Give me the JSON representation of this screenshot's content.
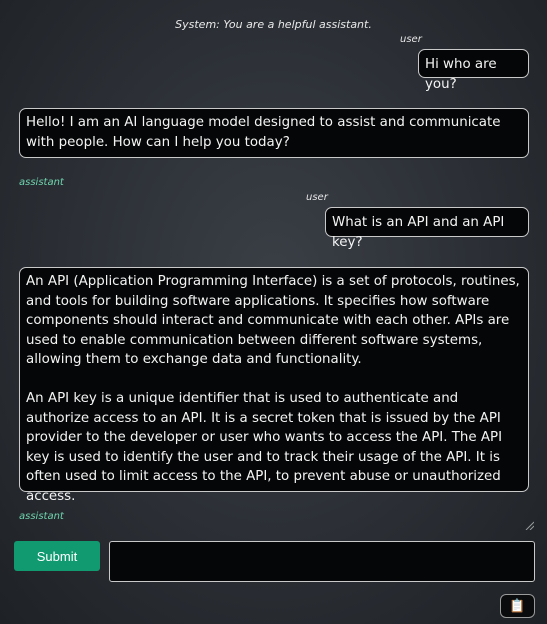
{
  "system_prompt": "System: You are a helpful assistant.",
  "messages": [
    {
      "role": "user",
      "role_label": "user",
      "text": "Hi who are you?"
    },
    {
      "role": "assistant",
      "role_label": "assistant",
      "text": "Hello! I am an AI language model designed to assist and communicate with people. How can I help you today?"
    },
    {
      "role": "user",
      "role_label": "user",
      "text": "What is an API and an API key?"
    },
    {
      "role": "assistant",
      "role_label": "assistant",
      "text": "An API (Application Programming Interface) is a set of protocols, routines, and tools for building software applications. It specifies how software components should interact and communicate with each other. APIs are used to enable communication between different software systems, allowing them to exchange data and functionality.\n\nAn API key is a unique identifier that is used to authenticate and authorize access to an API. It is a secret token that is issued by the API provider to the developer or user who wants to access the API. The API key is used to identify the user and to track their usage of the API. It is often used to limit access to the API, to prevent abuse or unauthorized access."
    }
  ],
  "composer": {
    "submit_label": "Submit",
    "input_value": "",
    "input_placeholder": ""
  },
  "clipboard_icon": "clipboard-icon",
  "colors": {
    "accent": "#119a70",
    "assistant_label": "#6fd3ad",
    "bubble_bg": "#050607",
    "bubble_border": "#c9c9c9"
  }
}
